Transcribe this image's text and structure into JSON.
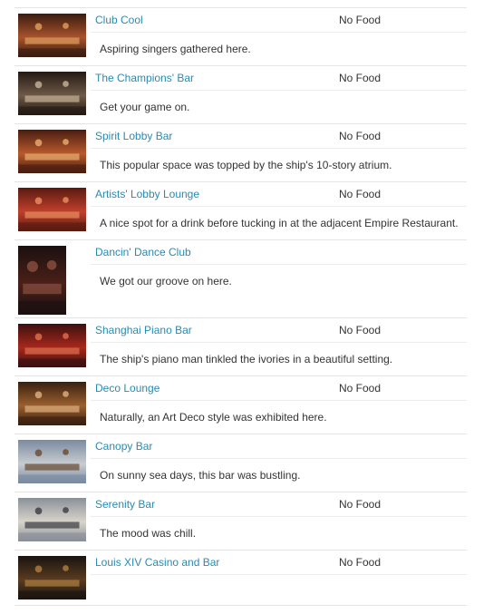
{
  "venues": [
    {
      "name": "Club Cool",
      "food": "No Food",
      "description": "Aspiring singers gathered here.",
      "thumb": "club-icon",
      "colors": [
        "#3a1c10",
        "#a8532c",
        "#e0a060"
      ]
    },
    {
      "name": "The Champions' Bar",
      "food": "No Food",
      "description": "Get your game on.",
      "thumb": "sports-bar-icon",
      "colors": [
        "#241a14",
        "#6e5a48",
        "#c9b498"
      ]
    },
    {
      "name": "Spirit Lobby Bar",
      "food": "No Food",
      "description": "This popular space was topped by the ship's 10-story atrium.",
      "thumb": "lobby-bar-icon",
      "colors": [
        "#4a1d10",
        "#b85a2c",
        "#e8b070"
      ]
    },
    {
      "name": "Artists' Lobby Lounge",
      "food": "No Food",
      "description": "A nice spot for a drink before tucking in at the adjacent Empire Restaurant.",
      "thumb": "lounge-icon",
      "colors": [
        "#5a1a10",
        "#c0402c",
        "#e89060"
      ]
    },
    {
      "name": "Dancin' Dance Club",
      "food": "",
      "description": "We got our groove on here.",
      "thumb": "dance-club-icon",
      "colors": [
        "#1c1010",
        "#4a2018",
        "#8a5040"
      ]
    },
    {
      "name": "Shanghai Piano Bar",
      "food": "No Food",
      "description": "The ship's piano man tinkled the ivories in a beautiful setting.",
      "thumb": "piano-bar-icon",
      "colors": [
        "#3c1010",
        "#a8281c",
        "#e07050"
      ]
    },
    {
      "name": "Deco Lounge",
      "food": "No Food",
      "description": "Naturally, an Art Deco style was exhibited here.",
      "thumb": "deco-lounge-icon",
      "colors": [
        "#3a2010",
        "#9a6030",
        "#e0b080"
      ]
    },
    {
      "name": "Canopy Bar",
      "food": "",
      "description": "On sunny sea days, this bar was bustling.",
      "thumb": "canopy-bar-icon",
      "colors": [
        "#7a8aa0",
        "#c8ccd0",
        "#6a4a30"
      ]
    },
    {
      "name": "Serenity Bar",
      "food": "No Food",
      "description": "The mood was chill.",
      "thumb": "serenity-bar-icon",
      "colors": [
        "#8a9098",
        "#d8d4cc",
        "#3a3a40"
      ]
    },
    {
      "name": "Louis XIV Casino and Bar",
      "food": "No Food",
      "description": "",
      "thumb": "casino-icon",
      "colors": [
        "#1a1410",
        "#5a3c20",
        "#b08040"
      ]
    }
  ]
}
